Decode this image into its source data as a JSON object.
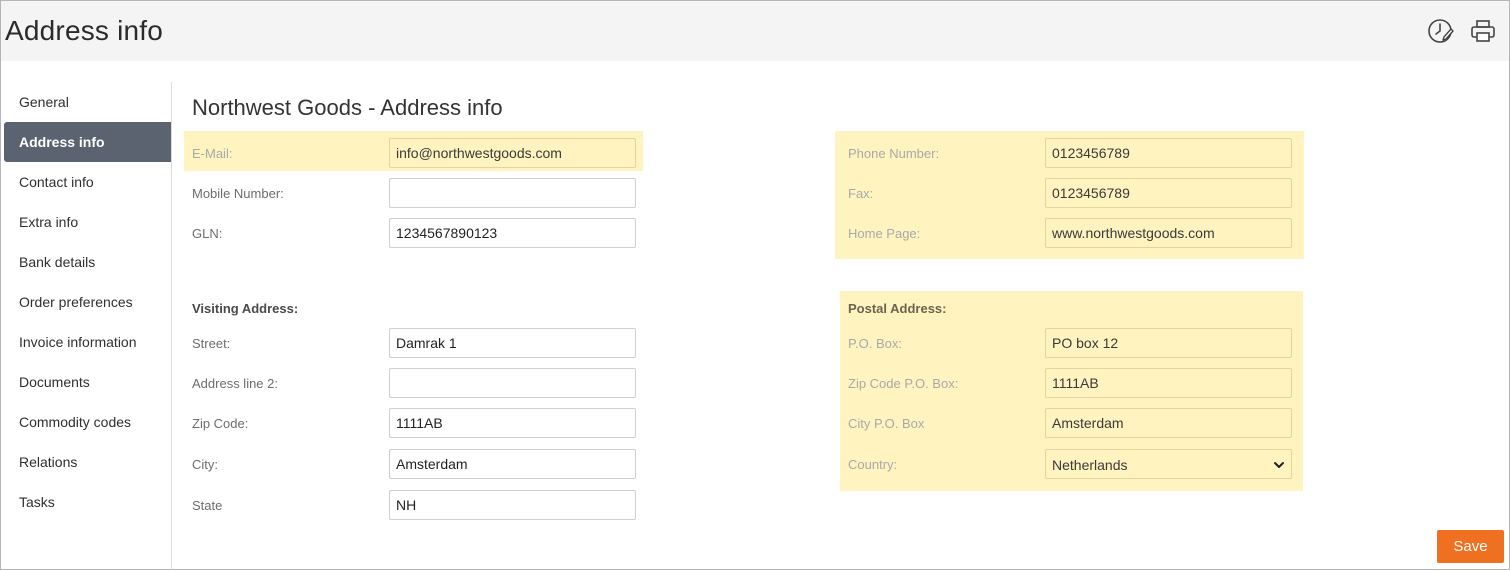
{
  "header": {
    "title": "Address info"
  },
  "sidebar": {
    "items": [
      {
        "label": "General",
        "active": false
      },
      {
        "label": "Address info",
        "active": true
      },
      {
        "label": "Contact info",
        "active": false
      },
      {
        "label": "Extra info",
        "active": false
      },
      {
        "label": "Bank details",
        "active": false
      },
      {
        "label": "Order preferences",
        "active": false
      },
      {
        "label": "Invoice information",
        "active": false
      },
      {
        "label": "Documents",
        "active": false
      },
      {
        "label": "Commodity codes",
        "active": false
      },
      {
        "label": "Relations",
        "active": false
      },
      {
        "label": "Tasks",
        "active": false
      }
    ]
  },
  "content": {
    "title": "Northwest Goods - Address info"
  },
  "left": {
    "email": {
      "label": "E-Mail:",
      "value": "info@northwestgoods.com"
    },
    "mobile": {
      "label": "Mobile Number:",
      "value": ""
    },
    "gln": {
      "label": "GLN:",
      "value": "1234567890123"
    },
    "visiting_title": "Visiting Address:",
    "street": {
      "label": "Street:",
      "value": "Damrak 1"
    },
    "address2": {
      "label": "Address line 2:",
      "value": ""
    },
    "zip": {
      "label": "Zip Code:",
      "value": "1111AB"
    },
    "city": {
      "label": "City:",
      "value": "Amsterdam"
    },
    "state": {
      "label": "State",
      "value": "NH"
    }
  },
  "right": {
    "phone": {
      "label": "Phone Number:",
      "value": "0123456789"
    },
    "fax": {
      "label": "Fax:",
      "value": "0123456789"
    },
    "homepage": {
      "label": "Home Page:",
      "value": "www.northwestgoods.com"
    },
    "postal_title": "Postal Address:",
    "pobox": {
      "label": "P.O. Box:",
      "value": "PO box 12"
    },
    "zip_pobox": {
      "label": "Zip Code P.O. Box:",
      "value": "1111AB"
    },
    "city_pobox": {
      "label": "City P.O. Box",
      "value": "Amsterdam"
    },
    "country": {
      "label": "Country:",
      "value": "Netherlands"
    }
  },
  "actions": {
    "save_label": "Save"
  },
  "colors": {
    "highlight": "#fff3bf",
    "active_nav": "#5b6270",
    "save": "#f07021"
  },
  "icons": {
    "history": "clock-edit-icon",
    "print": "printer-icon"
  }
}
